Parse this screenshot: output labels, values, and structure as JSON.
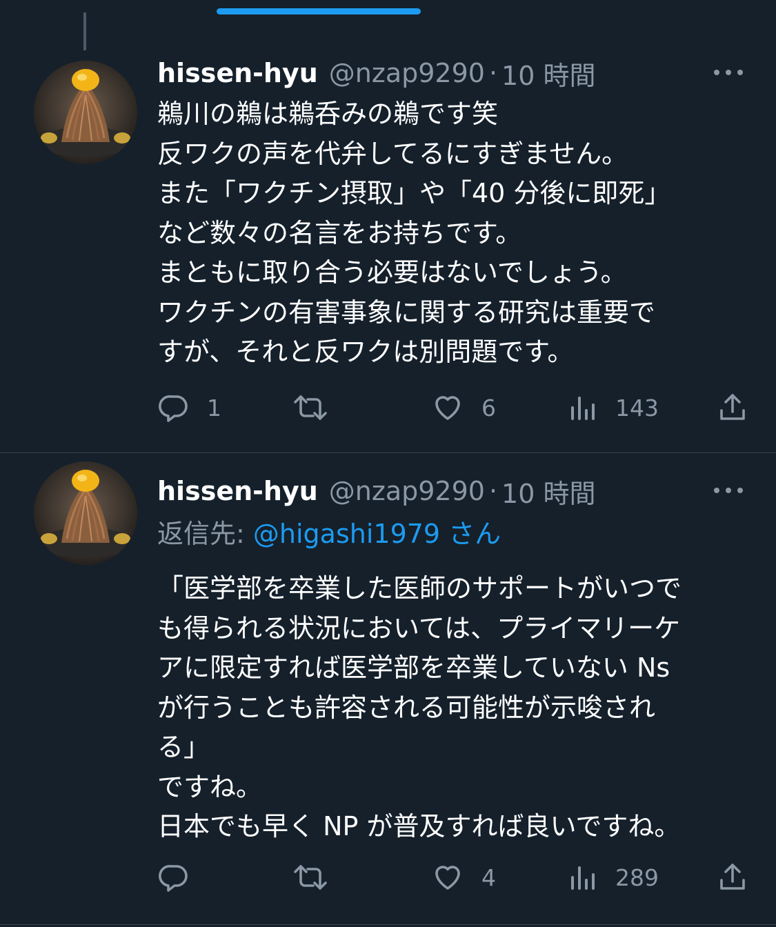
{
  "tweets": [
    {
      "author": {
        "display_name": "hissen-hyu",
        "handle": "@nzap9290",
        "time": "10 時間"
      },
      "separator": "·",
      "body_lines": [
        "鵜川の鵜は鵜呑みの鵜です笑",
        "反ワクの声を代弁してるにすぎません。",
        "また「ワクチン摂取」や「40 分後に即死」",
        "など数々の名言をお持ちです。",
        "まともに取り合う必要はないでしょう。",
        "ワクチンの有害事象に関する研究は重要で",
        "すが、それと反ワクは別問題です。"
      ],
      "actions": {
        "replies": "1",
        "retweets": "",
        "likes": "6",
        "views": "143"
      }
    },
    {
      "author": {
        "display_name": "hissen-hyu",
        "handle": "@nzap9290",
        "time": "10 時間"
      },
      "separator": "·",
      "reply_to": {
        "label": "返信先:",
        "mention": "@higashi1979 さん"
      },
      "body_lines": [
        "「医学部を卒業した医師のサポートがいつで",
        "も得られる状況においては、プライマリーケ",
        "アに限定すれば医学部を卒業していない Ns",
        "が行うことも許容される可能性が示唆され",
        "る」",
        "ですね。",
        "日本でも早く NP が普及すれば良いですね。"
      ],
      "actions": {
        "replies": "",
        "retweets": "",
        "likes": "4",
        "views": "289"
      }
    }
  ],
  "icons": {
    "reply": "reply-icon",
    "retweet": "retweet-icon",
    "like": "heart-icon",
    "views": "views-icon",
    "share": "share-icon",
    "more": "more-icon"
  },
  "colors": {
    "background": "#15202b",
    "text": "#ffffff",
    "secondary": "#8b98a5",
    "accent": "#1d9bf0",
    "divider": "#38444d"
  }
}
